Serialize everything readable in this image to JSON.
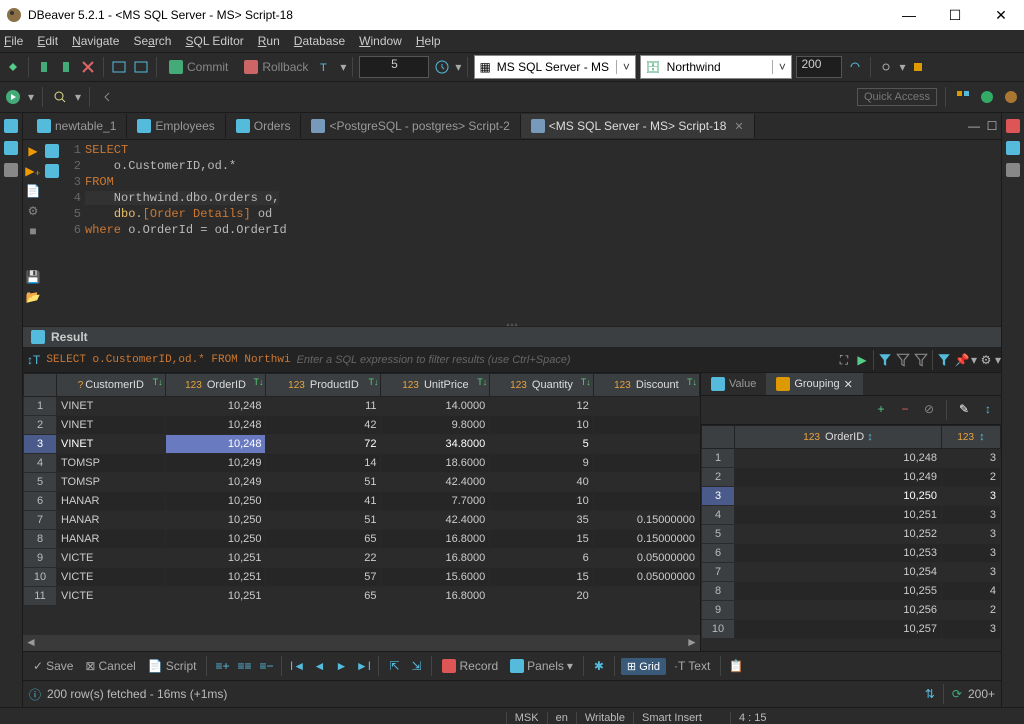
{
  "window": {
    "title": "DBeaver 5.2.1 - <MS SQL Server - MS> Script-18"
  },
  "menu": {
    "items": [
      "File",
      "Edit",
      "Navigate",
      "Search",
      "SQL Editor",
      "Run",
      "Database",
      "Window",
      "Help"
    ]
  },
  "toolbar": {
    "commit": "Commit",
    "rollback": "Rollback",
    "number": "5",
    "conn": "MS SQL Server - MS",
    "db": "Northwind",
    "limit": "200",
    "quick": "Quick Access"
  },
  "tabs": [
    {
      "label": "newtable_1"
    },
    {
      "label": "Employees"
    },
    {
      "label": "Orders"
    },
    {
      "label": "<PostgreSQL - postgres> Script-2"
    },
    {
      "label": "<MS SQL Server - MS> Script-18",
      "active": true
    }
  ],
  "code": {
    "lines": [
      "SELECT",
      "    o.CustomerID,od.*",
      "FROM",
      "    Northwind.dbo.Orders o,",
      "    dbo.[Order Details] od",
      "where o.OrderId = od.OrderId"
    ],
    "nums": [
      "1",
      "2",
      "3",
      "4",
      "5",
      "6"
    ]
  },
  "result": {
    "label": "Result",
    "filter_sql": "SELECT o.CustomerID,od.* FROM Northwi",
    "filter_ph": "Enter a SQL expression to filter results (use Ctrl+Space)"
  },
  "columns": [
    "CustomerID",
    "OrderID",
    "ProductID",
    "UnitPrice",
    "Quantity",
    "Discount"
  ],
  "col_types": [
    "?",
    "123",
    "123",
    "123",
    "123",
    "123"
  ],
  "rows": [
    {
      "n": "1",
      "c": [
        "VINET",
        "10,248",
        "11",
        "14.0000",
        "12",
        ""
      ]
    },
    {
      "n": "2",
      "c": [
        "VINET",
        "10,248",
        "42",
        "9.8000",
        "10",
        ""
      ]
    },
    {
      "n": "3",
      "c": [
        "VINET",
        "10,248",
        "72",
        "34.8000",
        "5",
        ""
      ],
      "sel": true
    },
    {
      "n": "4",
      "c": [
        "TOMSP",
        "10,249",
        "14",
        "18.6000",
        "9",
        ""
      ]
    },
    {
      "n": "5",
      "c": [
        "TOMSP",
        "10,249",
        "51",
        "42.4000",
        "40",
        ""
      ]
    },
    {
      "n": "6",
      "c": [
        "HANAR",
        "10,250",
        "41",
        "7.7000",
        "10",
        ""
      ]
    },
    {
      "n": "7",
      "c": [
        "HANAR",
        "10,250",
        "51",
        "42.4000",
        "35",
        "0.15000000"
      ]
    },
    {
      "n": "8",
      "c": [
        "HANAR",
        "10,250",
        "65",
        "16.8000",
        "15",
        "0.15000000"
      ]
    },
    {
      "n": "9",
      "c": [
        "VICTE",
        "10,251",
        "22",
        "16.8000",
        "6",
        "0.05000000"
      ]
    },
    {
      "n": "10",
      "c": [
        "VICTE",
        "10,251",
        "57",
        "15.6000",
        "15",
        "0.05000000"
      ]
    },
    {
      "n": "11",
      "c": [
        "VICTE",
        "10,251",
        "65",
        "16.8000",
        "20",
        ""
      ]
    }
  ],
  "grouping": {
    "tabs": {
      "value": "Value",
      "grouping": "Grouping"
    },
    "cols": [
      "OrderID",
      "123"
    ],
    "rows": [
      {
        "n": "1",
        "c": [
          "10,248",
          "3"
        ]
      },
      {
        "n": "2",
        "c": [
          "10,249",
          "2"
        ]
      },
      {
        "n": "3",
        "c": [
          "10,250",
          "3"
        ],
        "sel": true
      },
      {
        "n": "4",
        "c": [
          "10,251",
          "3"
        ]
      },
      {
        "n": "5",
        "c": [
          "10,252",
          "3"
        ]
      },
      {
        "n": "6",
        "c": [
          "10,253",
          "3"
        ]
      },
      {
        "n": "7",
        "c": [
          "10,254",
          "3"
        ]
      },
      {
        "n": "8",
        "c": [
          "10,255",
          "4"
        ]
      },
      {
        "n": "9",
        "c": [
          "10,256",
          "2"
        ]
      },
      {
        "n": "10",
        "c": [
          "10,257",
          "3"
        ]
      }
    ]
  },
  "bottb": {
    "save": "Save",
    "cancel": "Cancel",
    "script": "Script",
    "record": "Record",
    "panels": "Panels",
    "grid": "Grid",
    "text": "Text"
  },
  "fetch": {
    "msg": "200 row(s) fetched - 16ms (+1ms)",
    "more": "200+"
  },
  "status": {
    "msk": "MSK",
    "lang": "en",
    "writable": "Writable",
    "insert": "Smart Insert",
    "pos": "4 : 15"
  }
}
